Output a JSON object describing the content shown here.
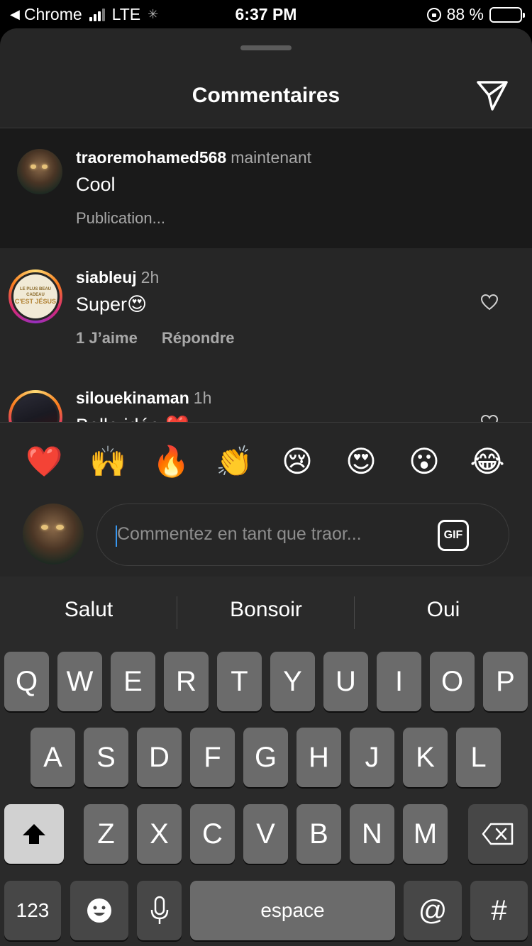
{
  "status_bar": {
    "back_app": "Chrome",
    "network": "LTE",
    "time": "6:37 PM",
    "battery_text": "88 %",
    "battery_level": 0.88,
    "battery_color": "#ffd60a"
  },
  "sheet": {
    "title": "Commentaires"
  },
  "comments": [
    {
      "username": "traoremohamed568",
      "time": "maintenant",
      "text": "Cool",
      "status": "Publication..."
    },
    {
      "username": "siableuj",
      "time": "2h",
      "text": "Super😍",
      "likes": "1 J’aime",
      "reply": "Répondre",
      "avatar_text": [
        "LE PLUS BEAU CADEAU",
        "C'EST JÉSUS"
      ]
    },
    {
      "username": "silouekinaman",
      "time": "1h",
      "text": "Belle idée ❤️"
    }
  ],
  "emoji_bar": [
    "❤️",
    "🙌",
    "🔥",
    "👏",
    "😢",
    "😍",
    "😮",
    "😂"
  ],
  "composer": {
    "placeholder": "Commentez en tant que traor...",
    "gif_label": "GIF"
  },
  "keyboard": {
    "suggestions": [
      "Salut",
      "Bonsoir",
      "Oui"
    ],
    "row1": [
      "Q",
      "W",
      "E",
      "R",
      "T",
      "Y",
      "U",
      "I",
      "O",
      "P"
    ],
    "row2": [
      "A",
      "S",
      "D",
      "F",
      "G",
      "H",
      "J",
      "K",
      "L"
    ],
    "row3": [
      "Z",
      "X",
      "C",
      "V",
      "B",
      "N",
      "M"
    ],
    "numbers_key": "123",
    "space_key": "espace",
    "at_key": "@",
    "hash_key": "#"
  },
  "colors": {
    "accent_blue": "#3897f0",
    "story_ring": [
      "#feda75",
      "#fa7e1e",
      "#d62976",
      "#962fbf"
    ]
  }
}
